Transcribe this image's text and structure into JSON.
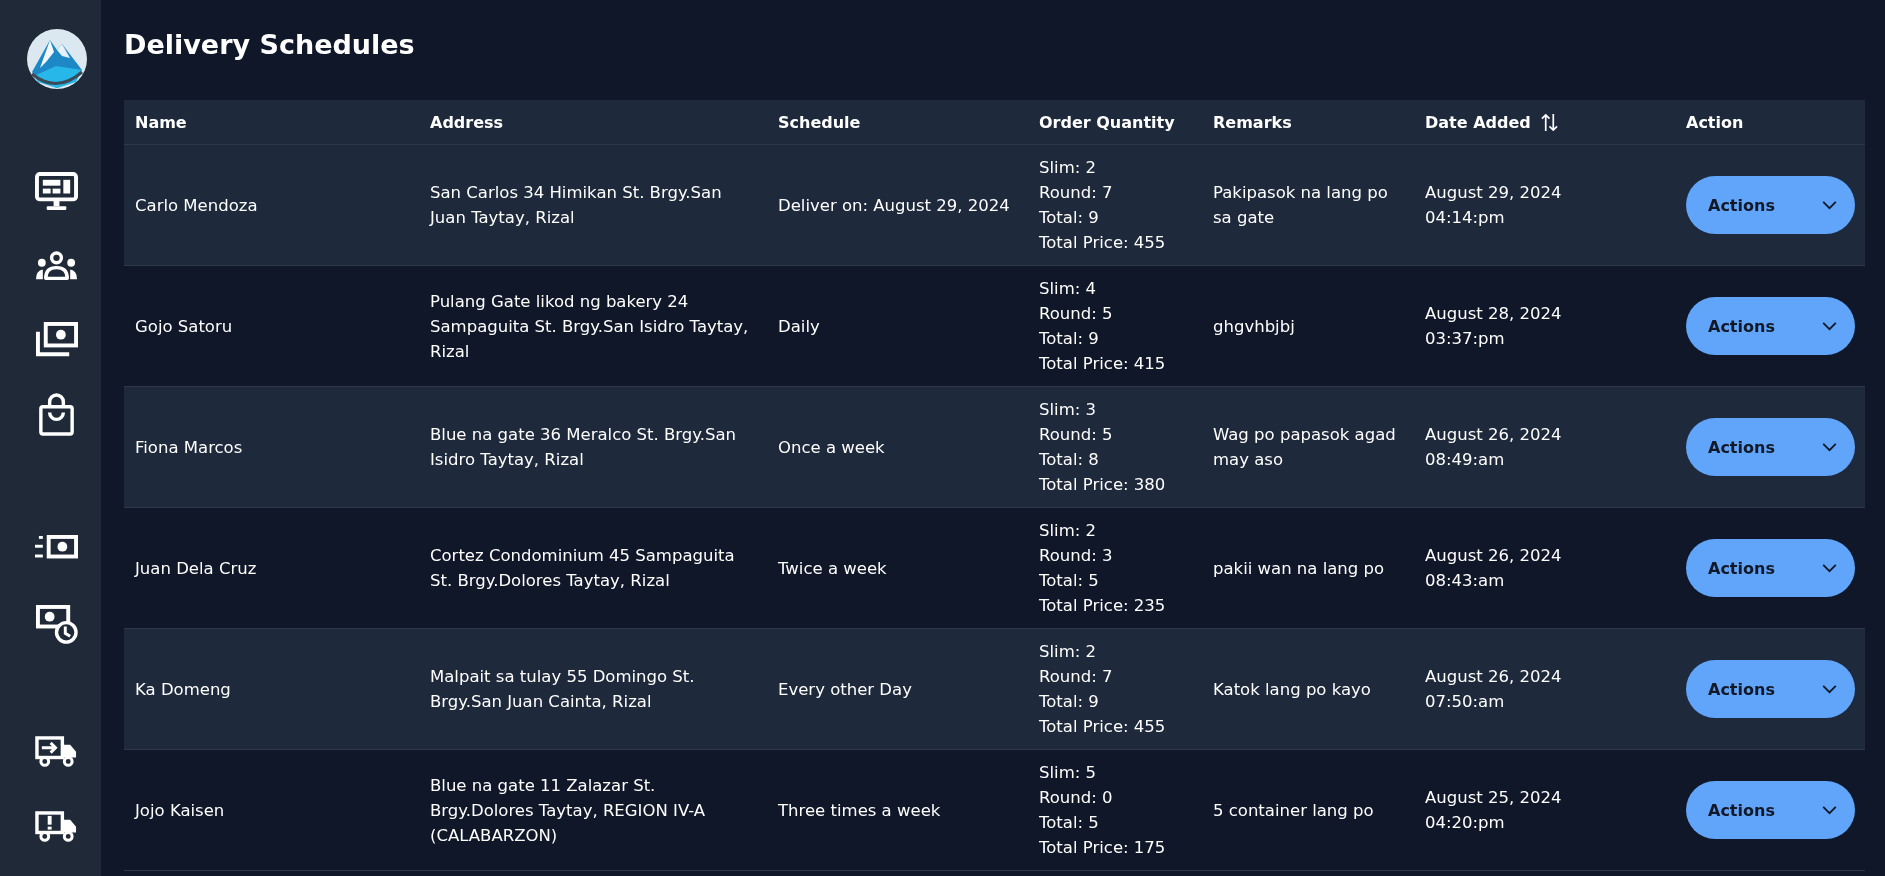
{
  "page": {
    "title": "Delivery Schedules"
  },
  "table": {
    "columns": [
      {
        "label": "Name",
        "sortable": false
      },
      {
        "label": "Address",
        "sortable": false
      },
      {
        "label": "Schedule",
        "sortable": false
      },
      {
        "label": "Order Quantity",
        "sortable": false
      },
      {
        "label": "Remarks",
        "sortable": false
      },
      {
        "label": "Date Added",
        "sortable": true
      },
      {
        "label": "Action",
        "sortable": false
      }
    ],
    "rows": [
      {
        "name": "Carlo Mendoza",
        "address": "San Carlos 34 Himikan St. Brgy.San Juan Taytay, Rizal",
        "schedule": "Deliver on: August 29, 2024",
        "order_quantity": [
          "Slim: 2",
          "Round: 7",
          "Total: 9",
          "Total Price: 455"
        ],
        "remarks": "Pakipasok na lang po sa gate",
        "date_added": {
          "date": "August 29, 2024",
          "time": "04:14:pm"
        },
        "action": "Actions"
      },
      {
        "name": "Gojo Satoru",
        "address": "Pulang Gate likod ng bakery 24 Sampaguita St. Brgy.San Isidro Taytay, Rizal",
        "schedule": "Daily",
        "order_quantity": [
          "Slim: 4",
          "Round: 5",
          "Total: 9",
          "Total Price: 415"
        ],
        "remarks": "ghgvhbjbj",
        "date_added": {
          "date": "August 28, 2024",
          "time": "03:37:pm"
        },
        "action": "Actions"
      },
      {
        "name": "Fiona Marcos",
        "address": "Blue na gate 36 Meralco St. Brgy.San Isidro Taytay, Rizal",
        "schedule": "Once a week",
        "order_quantity": [
          "Slim: 3",
          "Round: 5",
          "Total: 8",
          "Total Price: 380"
        ],
        "remarks": "Wag po papasok agad may aso",
        "date_added": {
          "date": "August 26, 2024",
          "time": "08:49:am"
        },
        "action": "Actions"
      },
      {
        "name": "Juan Dela Cruz",
        "address": "Cortez Condominium 45 Sampaguita St. Brgy.Dolores Taytay, Rizal",
        "schedule": "Twice a week",
        "order_quantity": [
          "Slim: 2",
          "Round: 3",
          "Total: 5",
          "Total Price: 235"
        ],
        "remarks": "pakii wan na lang po",
        "date_added": {
          "date": "August 26, 2024",
          "time": "08:43:am"
        },
        "action": "Actions"
      },
      {
        "name": "Ka Domeng",
        "address": "Malpait sa tulay 55 Domingo St. Brgy.San Juan Cainta, Rizal",
        "schedule": "Every other Day",
        "order_quantity": [
          "Slim: 2",
          "Round: 7",
          "Total: 9",
          "Total Price: 455"
        ],
        "remarks": "Katok lang po kayo",
        "date_added": {
          "date": "August 26, 2024",
          "time": "07:50:am"
        },
        "action": "Actions"
      },
      {
        "name": "Jojo Kaisen",
        "address": "Blue na gate 11 Zalazar St. Brgy.Dolores Taytay, REGION IV-A (CALABARZON)",
        "schedule": "Three times a week",
        "order_quantity": [
          "Slim: 5",
          "Round: 0",
          "Total: 5",
          "Total Price: 175"
        ],
        "remarks": "5 container lang po",
        "date_added": {
          "date": "August 25, 2024",
          "time": "04:20:pm"
        },
        "action": "Actions"
      }
    ]
  }
}
